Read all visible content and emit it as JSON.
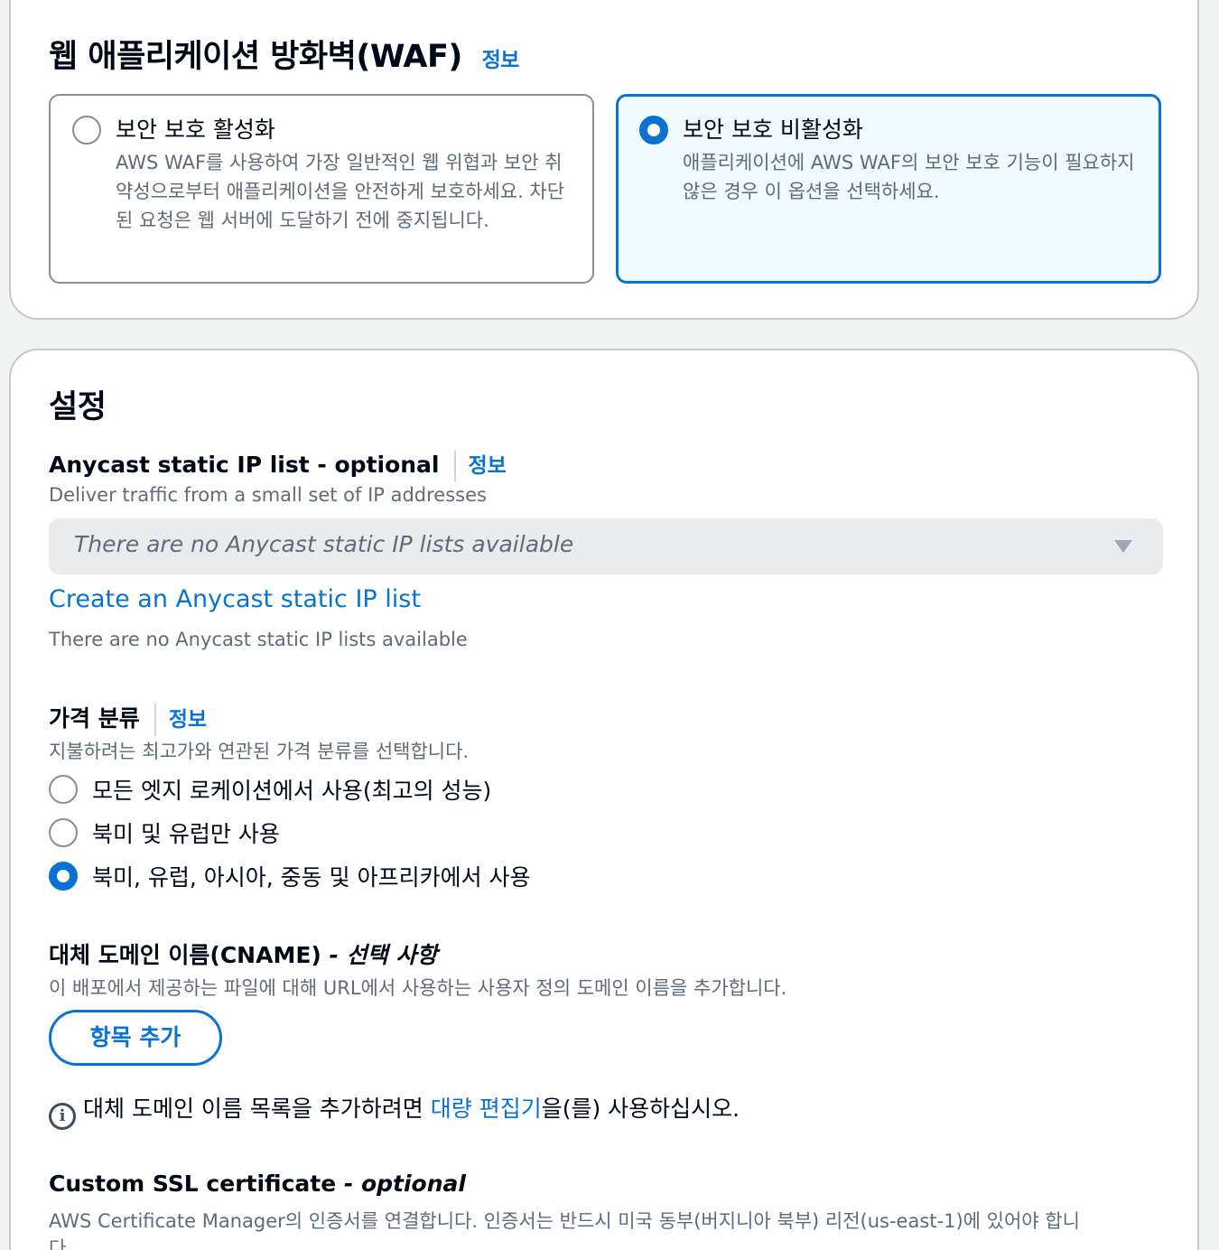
{
  "waf": {
    "title": "웹 애플리케이션 방화벽(WAF)",
    "info": "정보",
    "options": [
      {
        "title": "보안 보호 활성화",
        "description": "AWS WAF를 사용하여 가장 일반적인 웹 위협과 보안 취약성으로부터 애플리케이션을 안전하게 보호하세요. 차단된 요청은 웹 서버에 도달하기 전에 중지됩니다.",
        "selected": false
      },
      {
        "title": "보안 보호 비활성화",
        "description": "애플리케이션에 AWS WAF의 보안 보호 기능이 필요하지 않은 경우 이 옵션을 선택하세요.",
        "selected": true
      }
    ]
  },
  "settings": {
    "title": "설정",
    "anycast": {
      "label": "Anycast static IP list - optional",
      "info": "정보",
      "description": "Deliver traffic from a small set of IP addresses",
      "select_placeholder": "There are no Anycast static IP lists available",
      "create_link": "Create an Anycast static IP list",
      "note": "There are no Anycast static IP lists available"
    },
    "price_class": {
      "label": "가격 분류",
      "info": "정보",
      "description": "지불하려는 최고가와 연관된 가격 분류를 선택합니다.",
      "options": [
        {
          "label": "모든 엣지 로케이션에서 사용(최고의 성능)",
          "checked": false
        },
        {
          "label": "북미 및 유럽만 사용",
          "checked": false
        },
        {
          "label": "북미, 유럽, 아시아, 중동 및 아프리카에서 사용",
          "checked": true
        }
      ]
    },
    "cname": {
      "label": "대체 도메인 이름(CNAME)",
      "optional": " - 선택 사항",
      "description": "이 배포에서 제공하는 파일에 대해 URL에서 사용하는 사용자 정의 도메인 이름을 추가합니다.",
      "add_button": "항목 추가",
      "hint_before": "대체 도메인 이름 목록을 추가하려면 ",
      "hint_link": "대량 편집기",
      "hint_after": "을(를) 사용하십시오."
    },
    "ssl": {
      "label": "Custom SSL certificate",
      "optional": " - optional",
      "description_line1": "AWS Certificate Manager의 인증서를 연결합니다. 인증서는 반드시 미국 동부(버지니아 북부) 리전(us-east-1)에 있어야 합니",
      "description_line2": "다."
    }
  },
  "colors": {
    "accent": "#0972d3",
    "text": "#000716",
    "muted": "#5f6b7a",
    "border": "#8c8c94"
  }
}
